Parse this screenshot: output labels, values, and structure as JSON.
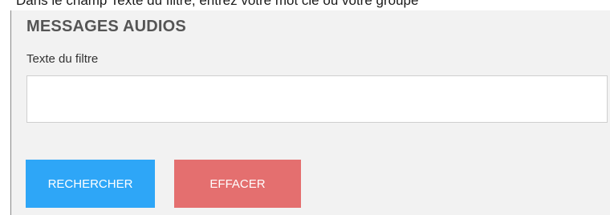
{
  "caption": "Dans le champ Texte du filtre, entrez votre mot clé ou votre groupe",
  "panel": {
    "title": "MESSAGES AUDIOS",
    "filter_label": "Texte du filtre",
    "filter_value": "",
    "filter_placeholder": ""
  },
  "buttons": {
    "search_label": "RECHERCHER",
    "clear_label": "EFFACER"
  },
  "colors": {
    "search_button": "#2ea6f7",
    "clear_button": "#e46f6f",
    "panel_background": "#f2f2f2",
    "title_text": "#555555"
  }
}
